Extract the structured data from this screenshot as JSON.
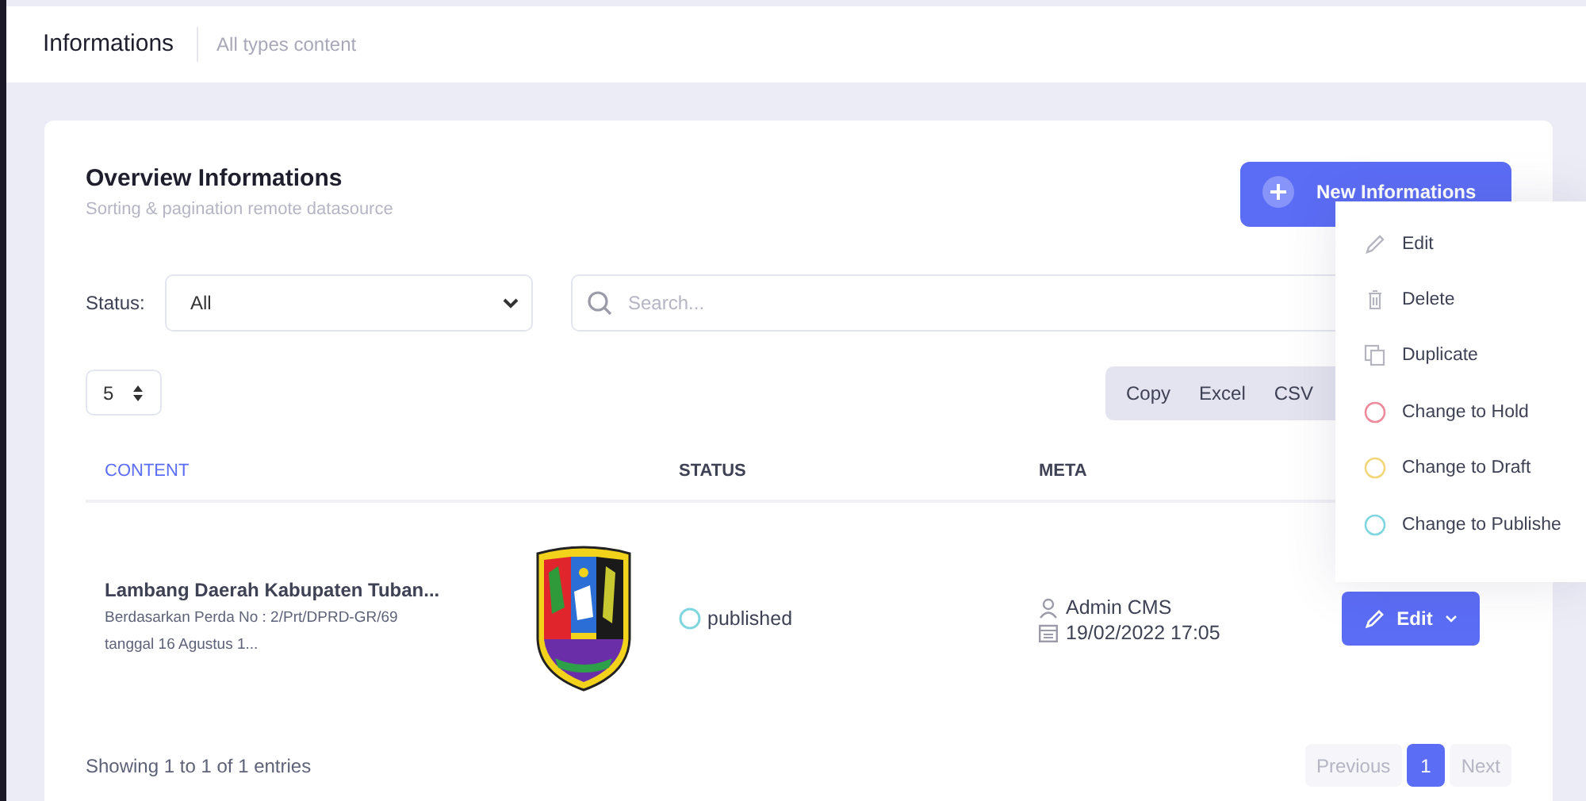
{
  "header": {
    "title": "Informations",
    "subtitle": "All types content"
  },
  "card": {
    "title": "Overview Informations",
    "subtitle": "Sorting & pagination remote datasource",
    "new_button": "New Informations"
  },
  "filters": {
    "status_label": "Status:",
    "status_value": "All",
    "search_placeholder": "Search..."
  },
  "page_size": "5",
  "export_buttons": [
    "Copy",
    "Excel",
    "CSV"
  ],
  "table": {
    "columns": [
      {
        "label": "CONTENT",
        "sorted": true
      },
      {
        "label": "STATUS",
        "sorted": false
      },
      {
        "label": "META",
        "sorted": false
      }
    ],
    "rows": [
      {
        "title": "Lambang Daerah Kabupaten Tuban...",
        "description": "Berdasarkan Perda No : 2/Prt/DPRD-GR/69 tanggal 16 Agustus 1...",
        "status": "published",
        "color": "#7fd6de",
        "author": "Admin CMS",
        "date": "19/02/2022 17:05",
        "action": "Edit"
      }
    ]
  },
  "footer": {
    "info": "Showing 1 to 1 of 1 entries",
    "pagination": [
      {
        "label": "Previous",
        "selected": false,
        "disabled": true
      },
      {
        "label": "1",
        "selected": true,
        "disabled": false
      },
      {
        "label": "Next",
        "selected": false,
        "disabled": true
      }
    ]
  },
  "action_menu": {
    "items": [
      {
        "label": "Edit",
        "kind": "edit"
      },
      {
        "label": "Delete",
        "kind": "delete"
      },
      {
        "label": "Duplicate",
        "kind": "duplicate"
      },
      {
        "label": "Change to Hold",
        "kind": "status",
        "color": "#ef8a9c"
      },
      {
        "label": "Change to Draft",
        "kind": "status",
        "color": "#f2d77a"
      },
      {
        "label": "Change to Publishe",
        "kind": "status",
        "color": "#7fd6de"
      }
    ]
  }
}
